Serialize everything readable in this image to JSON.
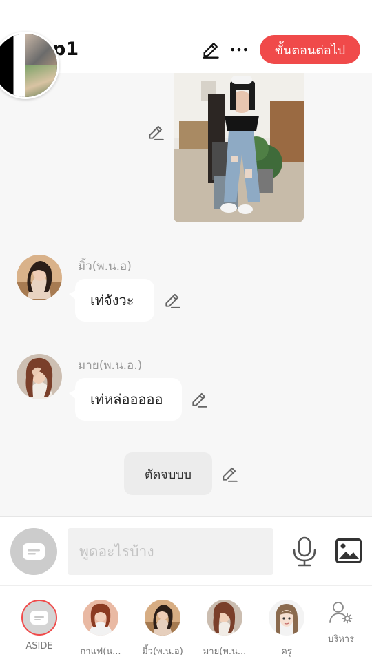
{
  "header": {
    "group_name": "p1",
    "next_label": "ขั้นตอนต่อไป"
  },
  "messages": [
    {
      "type": "image"
    },
    {
      "type": "text",
      "sender": "มิ้ว(พ.น.อ)",
      "text": "เท่จังวะ"
    },
    {
      "type": "text",
      "sender": "มาย(พ.น.อ.)",
      "text": "เท่หล่อออออ"
    },
    {
      "type": "narration",
      "text": "ตัดจบบบ"
    }
  ],
  "composer": {
    "placeholder": "พูดอะไรบ้าง"
  },
  "characters": [
    {
      "label": "ASIDE"
    },
    {
      "label": "กาแฟ(น..."
    },
    {
      "label": "มิ้ว(พ.น.อ)"
    },
    {
      "label": "มาย(พ.น..."
    },
    {
      "label": "ครู"
    },
    {
      "label": "บริหาร"
    }
  ],
  "icons": {
    "edit": "pencil-icon",
    "more": "ellipsis-icon",
    "mic": "microphone-icon",
    "image": "image-icon",
    "aside": "chat-bubble-icon",
    "manage": "user-gear-icon"
  },
  "colors": {
    "accent": "#f04a4a",
    "background": "#f7f7f7",
    "bubble": "#ffffff"
  }
}
